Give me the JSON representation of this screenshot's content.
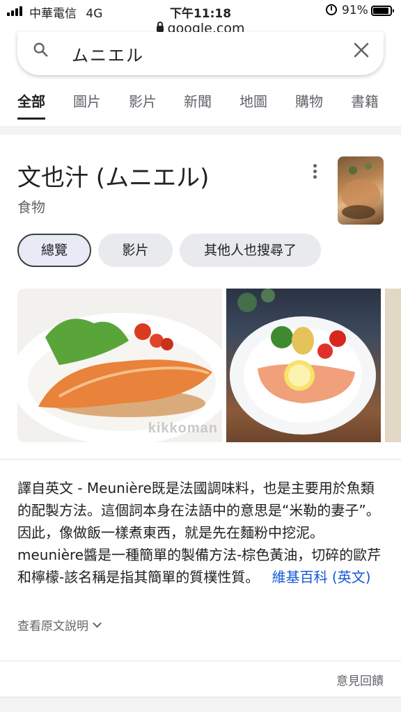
{
  "status_bar": {
    "carrier": "中華電信",
    "network": "4G",
    "time": "下午11:18",
    "battery_pct": "91%"
  },
  "address_bar": {
    "url": "google.com"
  },
  "search": {
    "query": "ムニエル"
  },
  "tabs": [
    {
      "label": "全部",
      "active": true
    },
    {
      "label": "圖片"
    },
    {
      "label": "影片"
    },
    {
      "label": "新聞"
    },
    {
      "label": "地圖"
    },
    {
      "label": "購物"
    },
    {
      "label": "書籍"
    }
  ],
  "knowledge_panel": {
    "title": "文也汁 (ムニエル)",
    "subtitle": "食物",
    "chips": [
      {
        "label": "總覽",
        "active": true
      },
      {
        "label": "影片"
      },
      {
        "label": "其他人也搜尋了"
      }
    ],
    "image_watermark": "kikkoman",
    "description": "譯自英文 - Meunière既是法國調味料，也是主要用於魚類的配製方法。這個詞本身在法語中的意思是“米勒的妻子”。因此，像做飯一樣煮東西，就是先在麵粉中挖泥。meunière醬是一種簡單的製備方法-棕色黃油，切碎的歐芹和檸檬-該名稱是指其簡單的質樸性質。",
    "source_link": "維基百科 (英文)",
    "expand_label": "查看原文說明",
    "feedback_label": "意見回饋"
  },
  "colors": {
    "link": "#1558d6",
    "text": "#202124",
    "secondary": "#5f6368"
  }
}
